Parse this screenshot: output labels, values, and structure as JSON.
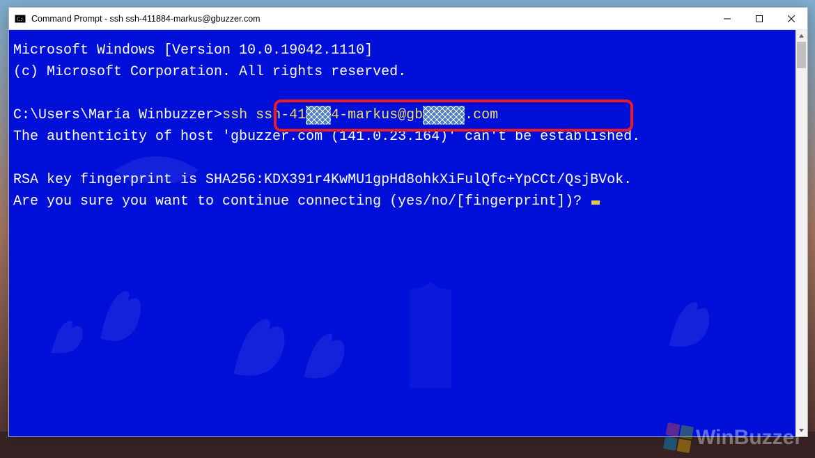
{
  "window": {
    "title": "Command Prompt - ssh  ssh-411884-markus@gbuzzer.com"
  },
  "term": {
    "line1": "Microsoft Windows [Version 10.0.19042.1110]",
    "line2": "(c) Microsoft Corporation. All rights reserved.",
    "prompt": "C:\\Users\\María Winbuzzer>",
    "cmd_a": "ssh ssh-41",
    "cmd_red1": "▒▒▒",
    "cmd_b": "4-markus@gb",
    "cmd_red2": "▒▒▒▒▒",
    "cmd_c": ".com",
    "line5": "The authenticity of host 'gbuzzer.com (141.0.23.164)' can't be established.",
    "line7": "RSA key fingerprint is SHA256:KDX391r4KwMU1gpHd8ohkXiFulQfc+YpCCt/QsjBVok.",
    "line8": "Are you sure you want to continue connecting (yes/no/[fingerprint])? "
  },
  "watermark": {
    "text": "WinBuzzer"
  }
}
